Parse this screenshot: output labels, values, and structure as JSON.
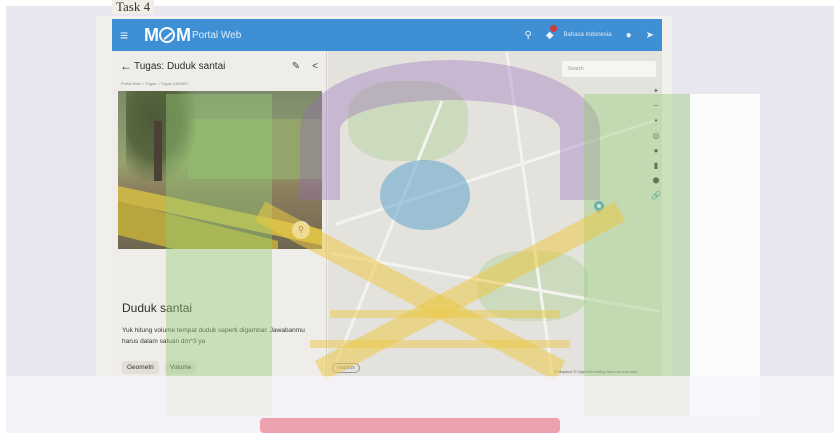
{
  "document_label": "Task 4",
  "topbar": {
    "logo_left": "M",
    "logo_right": "M",
    "logo_subtitle": "Portal Web",
    "language": "Bahasa Indonesia",
    "icons": [
      "menu-icon",
      "search-icon",
      "bell-icon",
      "user-icon",
      "logout-icon"
    ]
  },
  "panel": {
    "title": "Tugas: Duduk santai",
    "breadcrumb": "Portal Web  >  Tugas  >  Tugas 1340837",
    "card_title": "Duduk santai",
    "card_description": "Yuk hitung volume tempat duduk seperti digambar. Jawabanmu harus dalam satuan dm^3 ya",
    "tags": [
      "Geometri",
      "Volume"
    ]
  },
  "map": {
    "search_placeholder": "Search",
    "attribution": "© Mapbox © OpenStreetMap  Improve this map",
    "logo": "mapbox",
    "tools": [
      "+",
      "−",
      "•",
      "◎",
      "●",
      "▮",
      "⬢",
      "🔗"
    ]
  }
}
